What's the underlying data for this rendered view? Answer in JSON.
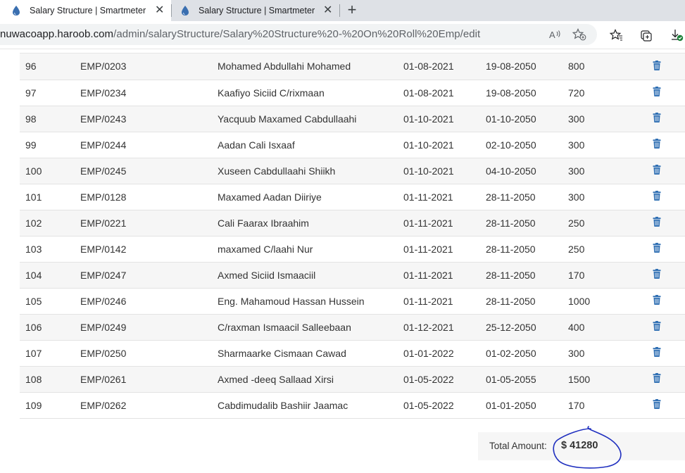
{
  "tabs": [
    {
      "title": "Salary Structure | Smartmeter",
      "active": true
    },
    {
      "title": "Salary Structure | Smartmeter",
      "active": false
    }
  ],
  "address_bar": {
    "url_prefix": "nuwacoapp.haroob.com",
    "url_path": "/admin/salaryStructure/Salary%20Structure%20-%20On%20Roll%20Emp/edit"
  },
  "toolbar_icons": [
    "read-aloud-icon",
    "add-favorite-icon",
    "favorites-icon",
    "collections-icon",
    "downloads-icon"
  ],
  "rows": [
    {
      "no": "96",
      "emp": "EMP/0203",
      "name": "Mohamed Abdullahi Mohamed",
      "start": "01-08-2021",
      "end": "19-08-2050",
      "amount": "800"
    },
    {
      "no": "97",
      "emp": "EMP/0234",
      "name": "Kaafiyo Siciid C/rixmaan",
      "start": "01-08-2021",
      "end": "19-08-2050",
      "amount": "720"
    },
    {
      "no": "98",
      "emp": "EMP/0243",
      "name": "Yacquub Maxamed Cabdullaahi",
      "start": "01-10-2021",
      "end": "01-10-2050",
      "amount": "300"
    },
    {
      "no": "99",
      "emp": "EMP/0244",
      "name": "Aadan Cali Isxaaf",
      "start": "01-10-2021",
      "end": "02-10-2050",
      "amount": "300"
    },
    {
      "no": "100",
      "emp": "EMP/0245",
      "name": "Xuseen Cabdullaahi Shiikh",
      "start": "01-10-2021",
      "end": "04-10-2050",
      "amount": "300"
    },
    {
      "no": "101",
      "emp": "EMP/0128",
      "name": "Maxamed Aadan Diiriye",
      "start": "01-11-2021",
      "end": "28-11-2050",
      "amount": "300"
    },
    {
      "no": "102",
      "emp": "EMP/0221",
      "name": "Cali Faarax Ibraahim",
      "start": "01-11-2021",
      "end": "28-11-2050",
      "amount": "250"
    },
    {
      "no": "103",
      "emp": "EMP/0142",
      "name": "maxamed C/laahi Nur",
      "start": "01-11-2021",
      "end": "28-11-2050",
      "amount": "250"
    },
    {
      "no": "104",
      "emp": "EMP/0247",
      "name": "Axmed Siciid Ismaaciil",
      "start": "01-11-2021",
      "end": "28-11-2050",
      "amount": "170"
    },
    {
      "no": "105",
      "emp": "EMP/0246",
      "name": "Eng. Mahamoud Hassan Hussein",
      "start": "01-11-2021",
      "end": "28-11-2050",
      "amount": "1000"
    },
    {
      "no": "106",
      "emp": "EMP/0249",
      "name": "C/raxman Ismaacil Salleebaan",
      "start": "01-12-2021",
      "end": "25-12-2050",
      "amount": "400"
    },
    {
      "no": "107",
      "emp": "EMP/0250",
      "name": "Sharmaarke Cismaan Cawad",
      "start": "01-01-2022",
      "end": "01-02-2050",
      "amount": "300"
    },
    {
      "no": "108",
      "emp": "EMP/0261",
      "name": "Axmed -deeq Sallaad Xirsi",
      "start": "01-05-2022",
      "end": "01-05-2055",
      "amount": "1500"
    },
    {
      "no": "109",
      "emp": "EMP/0262",
      "name": "Cabdimudalib Bashiir Jaamac",
      "start": "01-05-2022",
      "end": "01-01-2050",
      "amount": "170"
    }
  ],
  "row_action_icon": "trash-icon",
  "total": {
    "label": "Total Amount:",
    "value": "$ 41280"
  },
  "colors": {
    "trash": "#2f6fb3",
    "annotation": "#1f2fbf",
    "tab_strip": "#dee1e6"
  }
}
